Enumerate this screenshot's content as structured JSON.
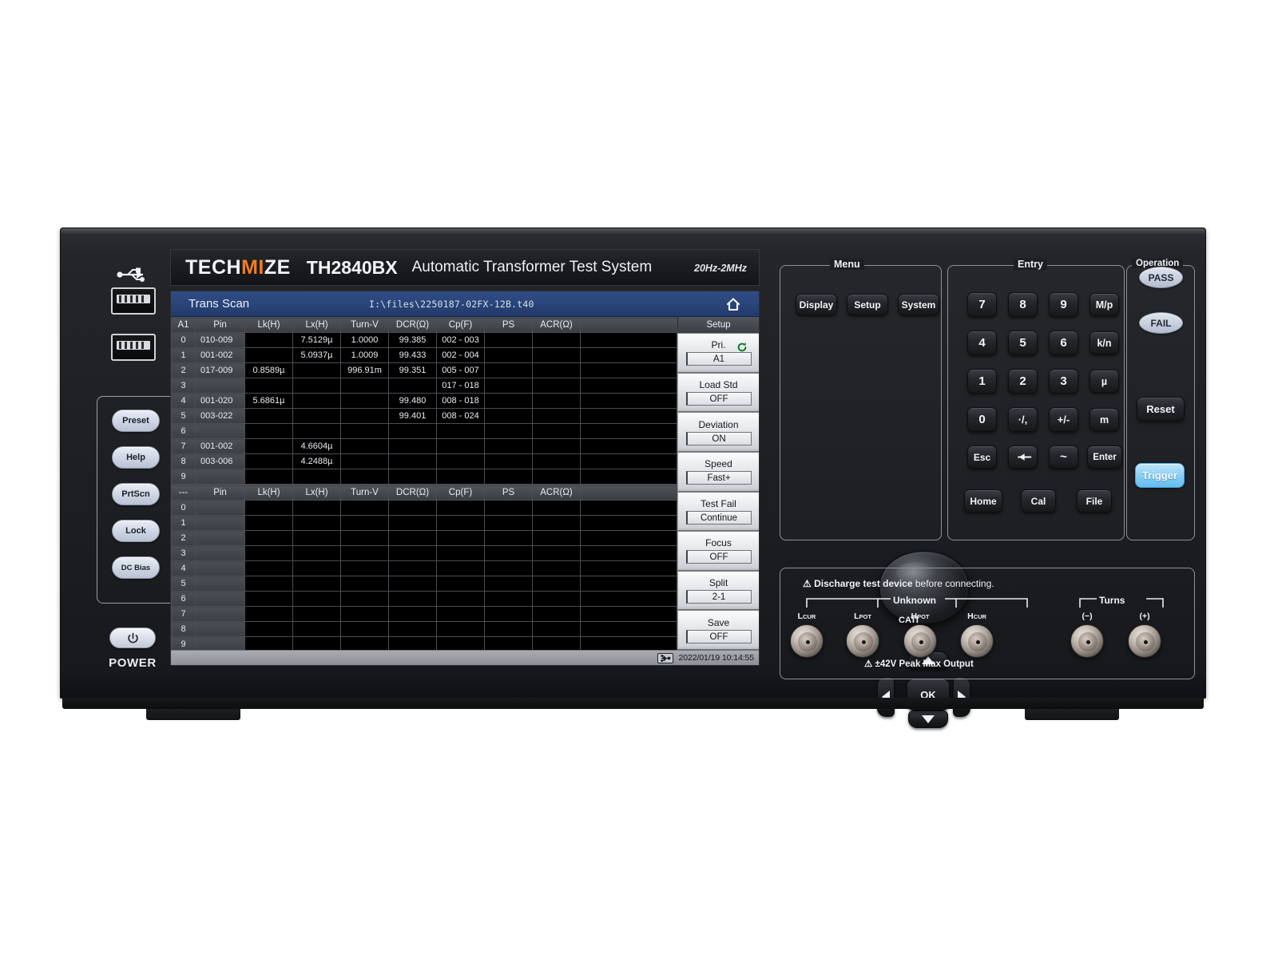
{
  "device": {
    "brand_left": "TECH",
    "brand_accent": "MI",
    "brand_right": "ZE",
    "model": "TH2840BX",
    "description": "Automatic Transformer Test System",
    "frequency_range": "20Hz-2MHz",
    "power_label": "POWER"
  },
  "screen": {
    "title": "Trans Scan",
    "file_path": "I:\\files\\2250187-02FX-12B.t40",
    "home_icon": "home-icon",
    "status": {
      "usb_icon": "usb-icon",
      "timestamp": "2022/01/19 10:14:55"
    }
  },
  "table_primary": {
    "headers": [
      "A1",
      "Pin",
      "Lk(H)",
      "Lx(H)",
      "Turn-V",
      "DCR(Ω)",
      "Cp(F)",
      "PS",
      "ACR(Ω)",
      ""
    ],
    "rows": [
      {
        "idx": "0",
        "pin": "010-009",
        "lk": "",
        "lk_c": "red",
        "lx": "7.5129µ",
        "lx_c": "red",
        "turn": "1.0000",
        "turn_c": "white",
        "dcr": "99.385",
        "dcr_c": "red",
        "cp": "002 - 003",
        "cp_c": "red",
        "ps": "",
        "acr": "",
        "tail": ""
      },
      {
        "idx": "1",
        "pin": "001-002",
        "lk": "",
        "lk_c": "red",
        "lx": "5.0937µ",
        "lx_c": "red",
        "turn": "1.0009",
        "turn_c": "white",
        "dcr": "99.433",
        "dcr_c": "red",
        "cp": "002 - 004",
        "cp_c": "red",
        "ps": "",
        "acr": "",
        "tail": ""
      },
      {
        "idx": "2",
        "pin": "017-009",
        "lk": "0.8589µ",
        "lk_c": "white",
        "lx": "",
        "lx_c": "red",
        "turn": "996.91m",
        "turn_c": "red",
        "dcr": "99.351",
        "dcr_c": "red",
        "cp": "005 - 007",
        "cp_c": "red",
        "ps": "",
        "acr": "",
        "tail": ""
      },
      {
        "idx": "3",
        "pin": "",
        "lk": "",
        "lk_c": "red",
        "lx": "",
        "lx_c": "red",
        "turn": "",
        "turn_c": "red",
        "dcr": "",
        "dcr_c": "red",
        "cp": "017 - 018",
        "cp_c": "red",
        "ps": "",
        "acr": "",
        "tail": ""
      },
      {
        "idx": "4",
        "pin": "001-020",
        "lk": "5.6861µ",
        "lk_c": "red",
        "lx": "",
        "lx_c": "red",
        "turn": "",
        "turn_c": "red",
        "dcr": "99.480",
        "dcr_c": "red",
        "cp": "008 - 018",
        "cp_c": "red",
        "ps": "",
        "acr": "",
        "tail": ""
      },
      {
        "idx": "5",
        "pin": "003-022",
        "lk": "",
        "lk_c": "red",
        "lx": "",
        "lx_c": "red",
        "turn": "",
        "turn_c": "red",
        "dcr": "99.401",
        "dcr_c": "red",
        "cp": "008 - 024",
        "cp_c": "red",
        "ps": "",
        "acr": "",
        "tail": ""
      },
      {
        "idx": "6",
        "pin": "",
        "lk": "",
        "lk_c": "red",
        "lx": "",
        "lx_c": "red",
        "turn": "",
        "turn_c": "red",
        "dcr": "",
        "dcr_c": "red",
        "cp": "",
        "cp_c": "red",
        "ps": "",
        "acr": "",
        "tail": ""
      },
      {
        "idx": "7",
        "pin": "001-002",
        "lk": "",
        "lk_c": "red",
        "lx": "4.6604µ",
        "lx_c": "red",
        "turn": "",
        "turn_c": "red",
        "dcr": "",
        "dcr_c": "red",
        "cp": "",
        "cp_c": "red",
        "ps": "",
        "acr": "",
        "tail": ""
      },
      {
        "idx": "8",
        "pin": "003-006",
        "lk": "",
        "lk_c": "red",
        "lx": "4.2488µ",
        "lx_c": "red",
        "turn": "",
        "turn_c": "red",
        "dcr": "",
        "dcr_c": "red",
        "cp": "",
        "cp_c": "red",
        "ps": "",
        "acr": "",
        "tail": ""
      },
      {
        "idx": "9",
        "pin": "",
        "lk": "",
        "lk_c": "red",
        "lx": "",
        "lx_c": "red",
        "turn": "",
        "turn_c": "red",
        "dcr": "",
        "dcr_c": "red",
        "cp": "",
        "cp_c": "red",
        "ps": "",
        "acr": "",
        "tail": ""
      }
    ]
  },
  "table_secondary": {
    "headers": [
      "---",
      "Pin",
      "Lk(H)",
      "Lx(H)",
      "Turn-V",
      "DCR(Ω)",
      "Cp(F)",
      "PS",
      "ACR(Ω)",
      ""
    ],
    "rows": [
      {
        "idx": "0"
      },
      {
        "idx": "1"
      },
      {
        "idx": "2"
      },
      {
        "idx": "3"
      },
      {
        "idx": "4"
      },
      {
        "idx": "5"
      },
      {
        "idx": "6"
      },
      {
        "idx": "7"
      },
      {
        "idx": "8"
      },
      {
        "idx": "9"
      }
    ]
  },
  "softkeys": {
    "header": "Setup",
    "items": [
      {
        "title": "Pri.",
        "value": "A1",
        "icon": "refresh-icon"
      },
      {
        "title": "Load Std",
        "value": "OFF"
      },
      {
        "title": "Deviation",
        "value": "ON"
      },
      {
        "title": "Speed",
        "value": "Fast+"
      },
      {
        "title": "Test Fail",
        "value": "Continue"
      },
      {
        "title": "Focus",
        "value": "OFF"
      },
      {
        "title": "Split",
        "value": "2-1"
      },
      {
        "title": "Save",
        "value": "OFF"
      }
    ]
  },
  "left_panel": {
    "usb_symbol": "usb-symbol-icon",
    "ports": [
      "usb-port-a-upper",
      "usb-port-a-lower"
    ],
    "buttons": [
      "Preset",
      "Help",
      "PrtScn",
      "Lock",
      "DC Bias"
    ],
    "power_icon": "power-icon"
  },
  "menu_panel": {
    "label": "Menu",
    "buttons": [
      "Display",
      "Setup",
      "System"
    ],
    "knob": "rotary-knob",
    "dpad": {
      "up": "arrow-up-icon",
      "down": "arrow-down-icon",
      "left": "arrow-left-icon",
      "right": "arrow-right-icon",
      "ok": "OK"
    }
  },
  "entry_panel": {
    "label": "Entry",
    "keys": [
      [
        "7",
        "8",
        "9",
        "M/p"
      ],
      [
        "4",
        "5",
        "6",
        "k/n"
      ],
      [
        "1",
        "2",
        "3",
        "µ"
      ],
      [
        "0",
        "·/,",
        "+/-",
        "m"
      ],
      [
        "Esc",
        "arrow-back-icon",
        "~",
        "Enter"
      ],
      [
        "Home",
        "Cal",
        "File"
      ]
    ]
  },
  "operation_panel": {
    "label": "Operation",
    "pass": "PASS",
    "fail": "FAIL",
    "reset": "Reset",
    "trigger": "Trigger",
    "trigger_color": "#86cdf6"
  },
  "connector_panel": {
    "warning_top_strong": "Discharge test device",
    "warning_top_thin": "before connecting.",
    "warning_bottom": "±42V Peak Max Output",
    "group_unknown": "Unknown",
    "group_turns": "Turns",
    "cat_rating": "CATⅠ",
    "terminals": [
      {
        "main": "L",
        "sub": "CUR"
      },
      {
        "main": "L",
        "sub": "POT"
      },
      {
        "main": "H",
        "sub": "POT"
      },
      {
        "main": "H",
        "sub": "CUR"
      }
    ],
    "turns_terminals": [
      {
        "main": "(−)"
      },
      {
        "main": "(+)"
      }
    ]
  }
}
